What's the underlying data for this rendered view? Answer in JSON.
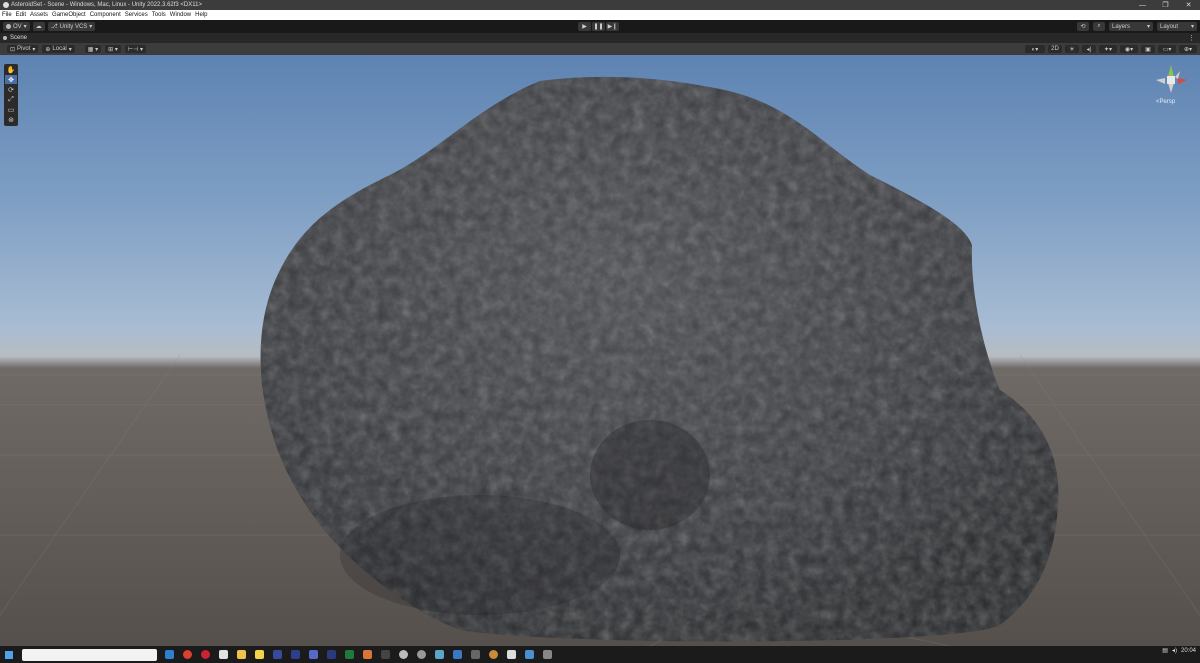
{
  "window": {
    "title": "AsteroidSet - Scene - Windows, Mac, Linux - Unity 2022.3.62f3 <DX11>",
    "controls": {
      "minimize": "—",
      "maximize": "❐",
      "close": "✕"
    }
  },
  "menu": [
    "File",
    "Edit",
    "Assets",
    "GameObject",
    "Component",
    "Services",
    "Tools",
    "Window",
    "Help"
  ],
  "toolbar": {
    "account": "OV",
    "vcs": "Unity VCS",
    "play": "▶",
    "pause": "❚❚",
    "step": "▶❙",
    "layers": "Layers",
    "layout": "Layout"
  },
  "scene": {
    "tab_label": "Scene",
    "pivot": "Pivot",
    "local": "Local",
    "mode_2d": "2D",
    "gizmo_view": "<Persp"
  },
  "taskbar": {
    "time": "20:04"
  },
  "colors": {
    "sky_top": "#5e83b2",
    "horizon": "#b7bcc2",
    "ground": "#56504c",
    "asteroid": "#3a3b3e",
    "menubar": "#ffffff",
    "selected_tool": "#4a6fa5"
  }
}
